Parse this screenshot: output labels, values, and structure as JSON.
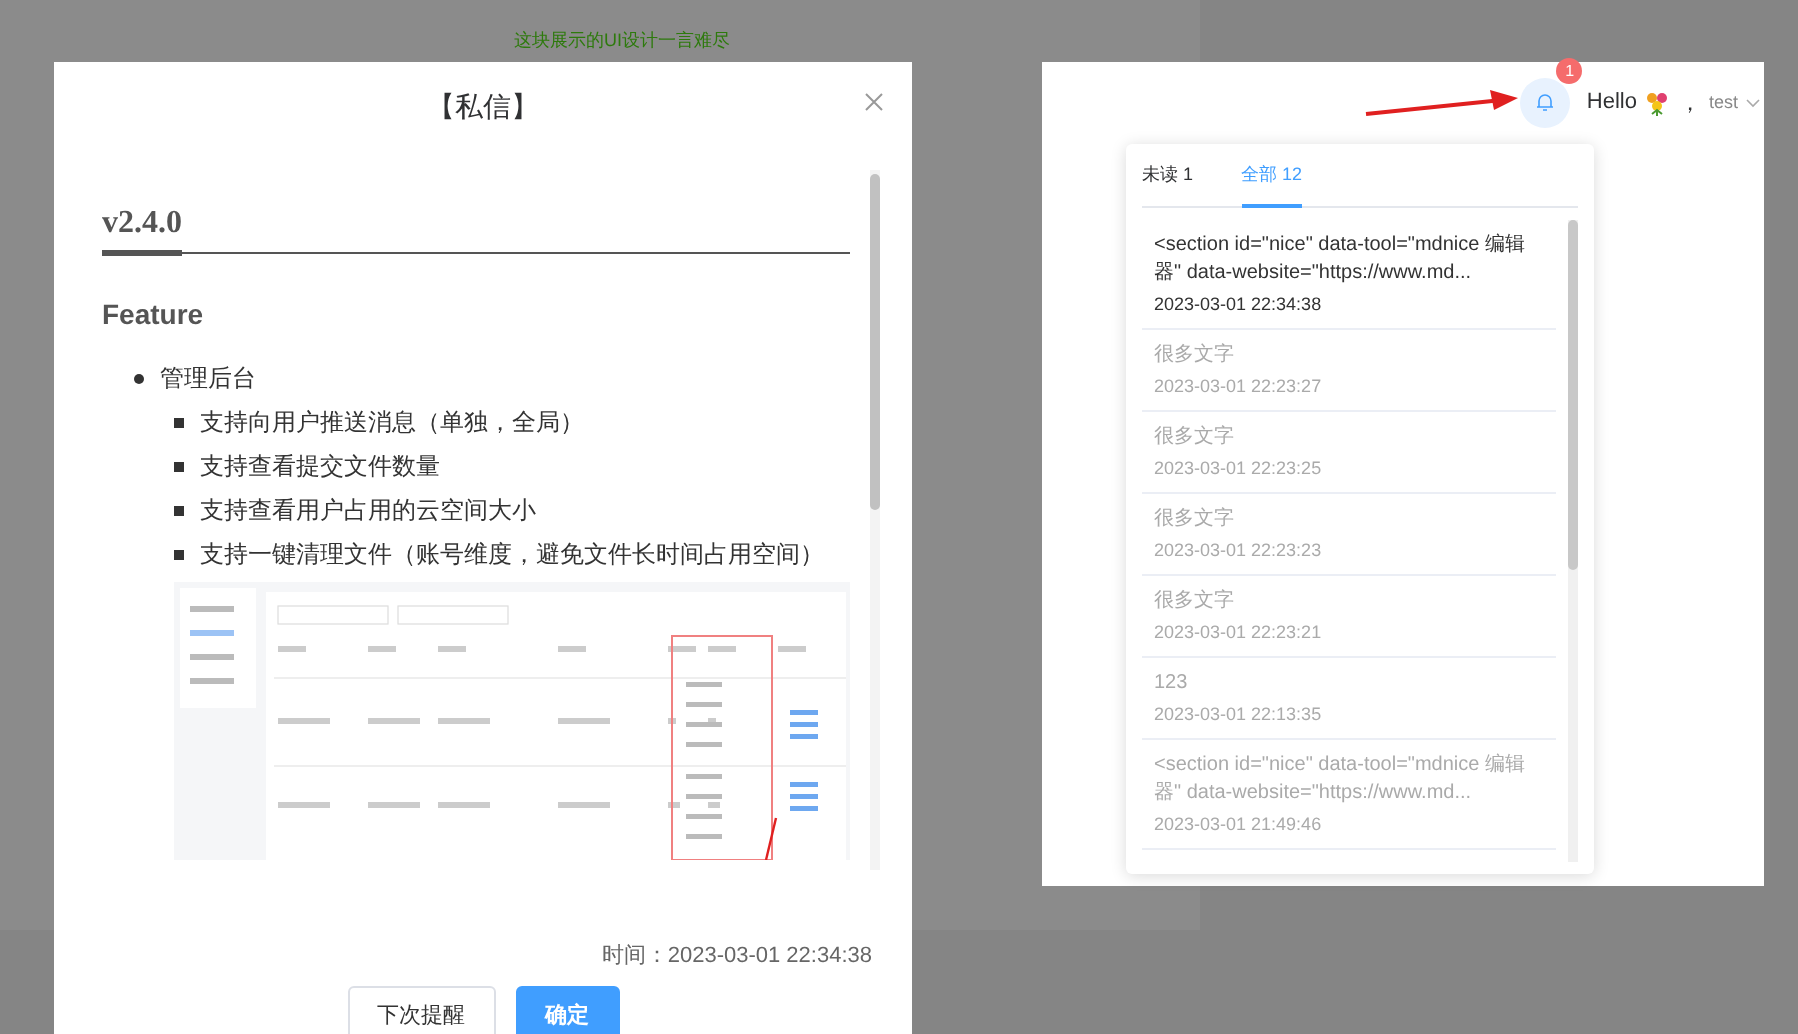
{
  "banner": "这块展示的UI设计一言难尽",
  "dialog": {
    "title": "【私信】",
    "heading": "v2.4.0",
    "subheading": "Feature",
    "list": [
      {
        "text": "管理后台",
        "children": [
          {
            "text": "支持向用户推送消息（单独，全局）"
          },
          {
            "text": "支持查看提交文件数量"
          },
          {
            "text": "支持查看用户占用的云空间大小"
          },
          {
            "text": "支持一键清理文件（账号维度，避免文件长时间占用空间）"
          }
        ]
      }
    ],
    "time": "时间：2023-03-01 22:34:38",
    "buttons": [
      {
        "label": "下次提醒",
        "kind": "default"
      },
      {
        "label": "确定",
        "kind": "primary"
      }
    ]
  },
  "header": {
    "badge": "1",
    "greeting": "Hello",
    "separator": "，",
    "user": "test"
  },
  "notifications": {
    "tabs": [
      {
        "label": "未读 1",
        "selected": false
      },
      {
        "label": "全部 12",
        "selected": true
      }
    ],
    "items": [
      {
        "text": "<section  id=\"nice\"  data-tool=\"mdnice 编辑器\"  data-website=\"https://www.md...",
        "time": "2023-03-01 22:34:38",
        "read": false
      },
      {
        "text": "很多文字",
        "time": "2023-03-01 22:23:27",
        "read": true
      },
      {
        "text": "很多文字",
        "time": "2023-03-01 22:23:25",
        "read": true
      },
      {
        "text": "很多文字",
        "time": "2023-03-01 22:23:23",
        "read": true
      },
      {
        "text": "很多文字",
        "time": "2023-03-01 22:23:21",
        "read": true
      },
      {
        "text": "123",
        "time": "2023-03-01 22:13:35",
        "read": true
      },
      {
        "text": "<section  id=\"nice\"  data-tool=\"mdnice 编辑器\"  data-website=\"https://www.md...",
        "time": "2023-03-01 21:49:46",
        "read": true
      }
    ]
  }
}
